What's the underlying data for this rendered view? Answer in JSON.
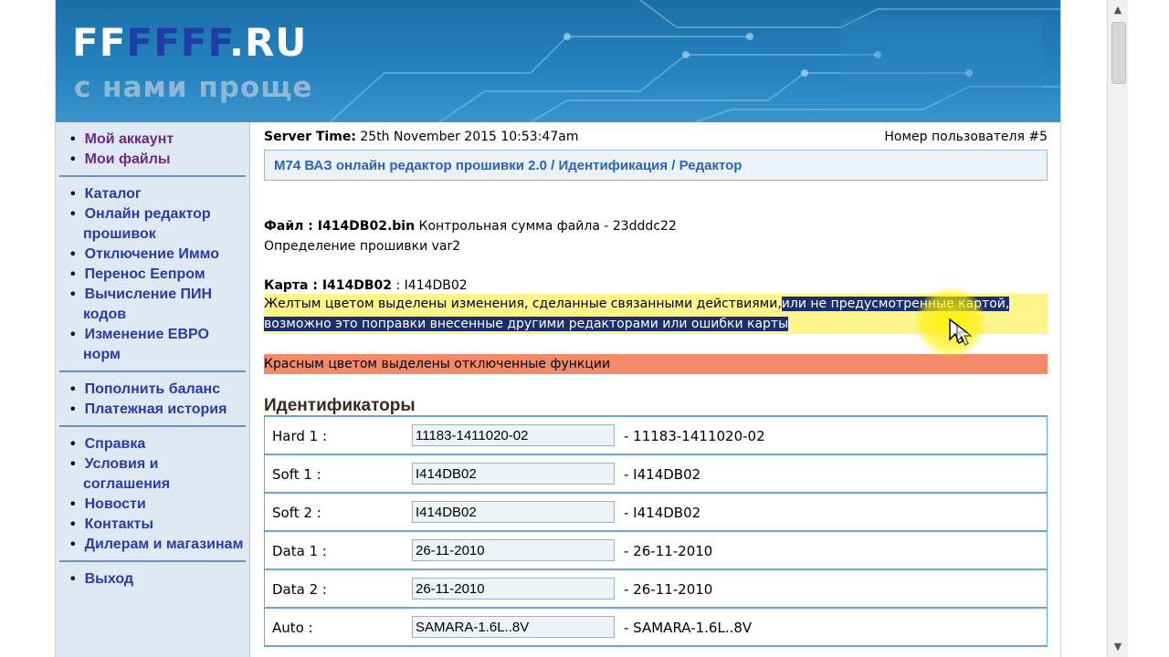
{
  "banner": {
    "logo_part1": "FF",
    "logo_part2": "FFFF",
    "logo_part3": ".RU",
    "tagline": "с нами проще"
  },
  "sidebar": {
    "groups": [
      {
        "items": [
          "Мой аккаунт",
          "Мои файлы"
        ]
      },
      {
        "items": [
          "Каталог",
          "Онлайн редактор прошивок",
          "Отключение Иммо",
          "Перенос Еепром",
          "Вычисление ПИН кодов",
          "Изменение ЕВРО норм"
        ]
      },
      {
        "items": [
          "Пополнить баланс",
          "Платежная история"
        ]
      },
      {
        "items": [
          "Справка",
          "Условия и соглашения",
          "Новости",
          "Контакты",
          "Дилерам и магазинам"
        ]
      },
      {
        "items": [
          "Выход"
        ]
      }
    ]
  },
  "header": {
    "server_time_label": "Server Time:",
    "server_time_value": "25th November 2015 10:53:47am",
    "user_number": "Номер пользователя #5",
    "breadcrumb": "M74 ВАЗ онлайн редактор прошивки 2.0 / Идентификация / Редактор"
  },
  "file_info": {
    "file_label": "Файл : I414DB02.bin",
    "checksum": "Контрольная сумма файла - 23dddc22",
    "firmware_def": "Определение прошивки var2",
    "map_label": "Карта : I414DB02",
    "map_value": ": I414DB02"
  },
  "notes": {
    "yellow_part1": "Желтым цветом выделены изменения, сделанные связанными действиями,",
    "yellow_part2_selected": "или не предусмотренные картой, возможно это поправки внесенные другими редакторами или ошибки карты",
    "red": "Красным цветом выделены отключенные функции",
    "yellow_color": "#fff48a",
    "red_color": "#f28a6a"
  },
  "identifiers": {
    "title": "Идентификаторы",
    "rows": [
      {
        "label": "Hard 1 :",
        "field": "11183-1411020-02",
        "value": "- 11183-1411020-02"
      },
      {
        "label": "Soft 1 :",
        "field": "I414DB02",
        "value": "- I414DB02"
      },
      {
        "label": "Soft 2 :",
        "field": "I414DB02",
        "value": "- I414DB02"
      },
      {
        "label": "Data 1 :",
        "field": "26-11-2010",
        "value": "- 26-11-2010"
      },
      {
        "label": "Data 2 :",
        "field": "26-11-2010",
        "value": "- 26-11-2010"
      },
      {
        "label": "Auto :",
        "field": "SAMARA-1.6L..8V",
        "value": "- SAMARA-1.6L..8V"
      }
    ]
  }
}
